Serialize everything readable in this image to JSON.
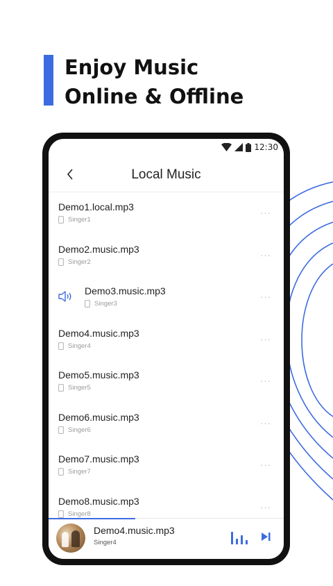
{
  "headline": {
    "line1": "Enjoy Music",
    "line2": "Online & Offline",
    "accent_color": "#3d6be0"
  },
  "status_bar": {
    "time": "12:30",
    "icons": [
      "wifi-icon",
      "cell-signal-icon",
      "battery-icon"
    ]
  },
  "header": {
    "title": "Local Music",
    "back_icon": "back-chevron-icon"
  },
  "songs": [
    {
      "title": "Demo1.local.mp3",
      "singer": "Singer1"
    },
    {
      "title": "Demo2.music.mp3",
      "singer": "Singer2"
    },
    {
      "title": "Demo3.music.mp3",
      "singer": "Singer3",
      "playing": true
    },
    {
      "title": "Demo4.music.mp3",
      "singer": "Singer4"
    },
    {
      "title": "Demo5.music.mp3",
      "singer": "Singer5"
    },
    {
      "title": "Demo6.music.mp3",
      "singer": "Singer6"
    },
    {
      "title": "Demo7.music.mp3",
      "singer": "Singer7"
    },
    {
      "title": "Demo8.music.mp3",
      "singer": "Singer8"
    }
  ],
  "more_label": "···",
  "player": {
    "title": "Demo4.music.mp3",
    "singer": "Singer4",
    "progress_fraction": 0.37,
    "icons": [
      "album-cover-icon",
      "equalizer-icon",
      "next-track-icon"
    ]
  }
}
